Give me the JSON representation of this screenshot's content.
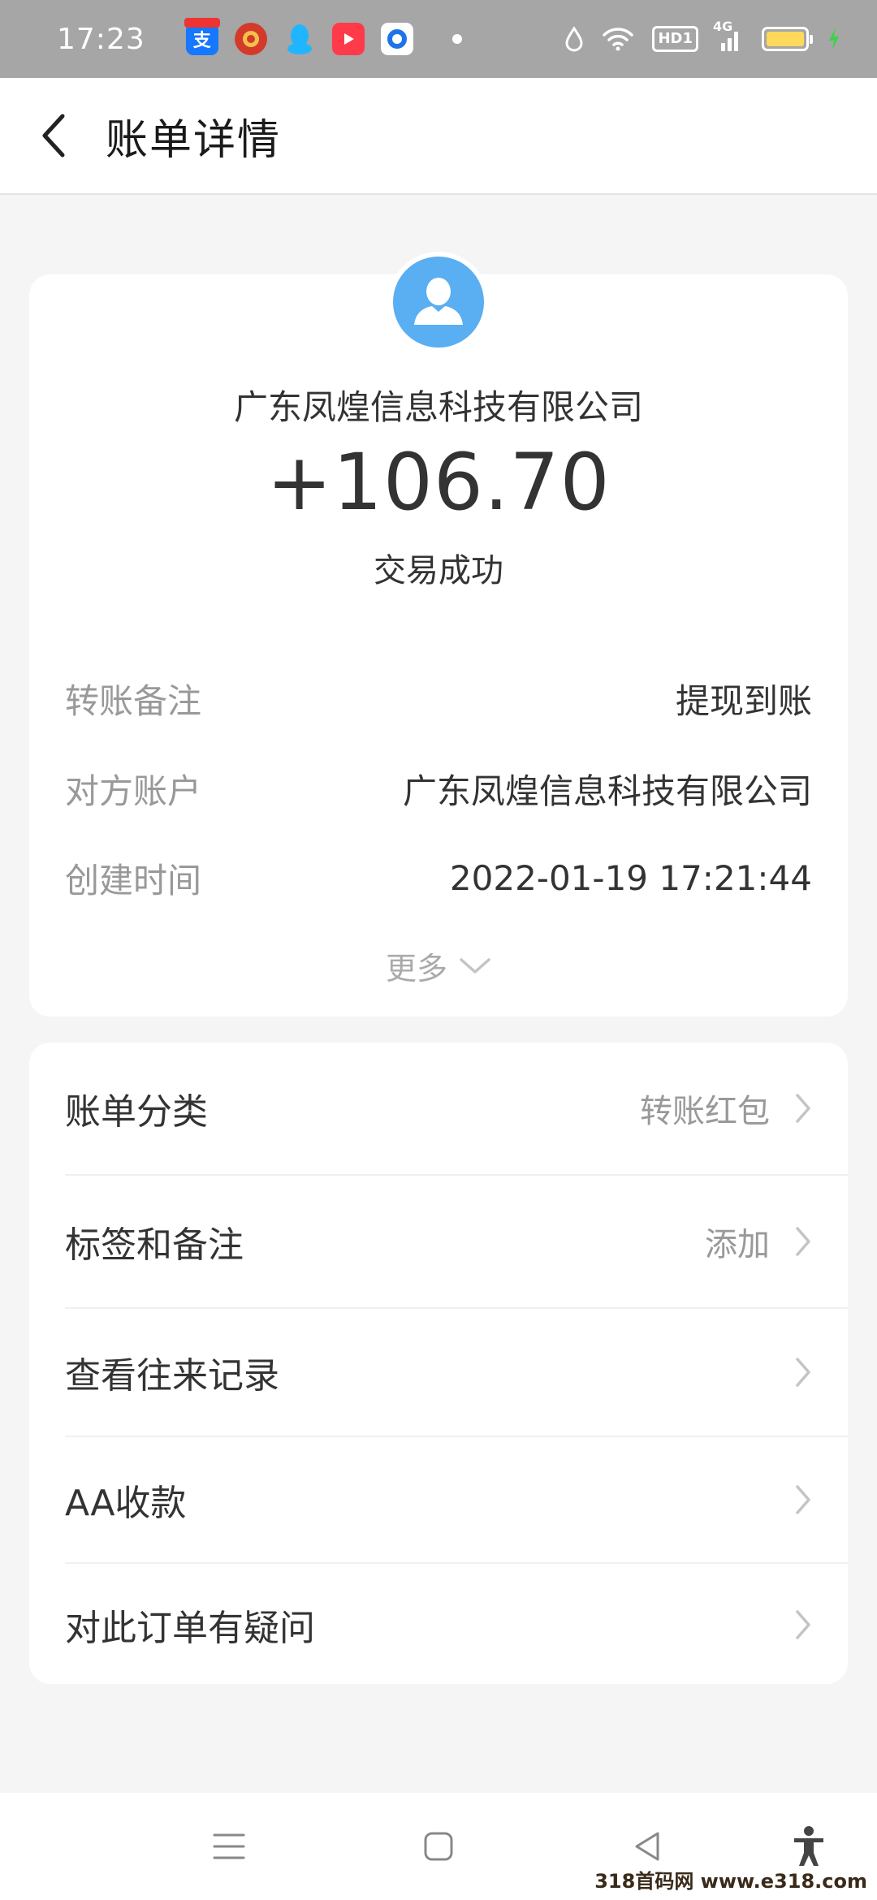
{
  "status_bar": {
    "time": "17:23",
    "network": "4G",
    "hd": "HD1",
    "notification_icons": [
      "alipay-icon",
      "emblem-icon",
      "qq-icon",
      "video-icon",
      "browser-icon"
    ]
  },
  "header": {
    "title": "账单详情"
  },
  "summary": {
    "counterparty": "广东凤煌信息科技有限公司",
    "amount": "+106.70",
    "status": "交易成功",
    "details": [
      {
        "label": "转账备注",
        "value": "提现到账"
      },
      {
        "label": "对方账户",
        "value": "广东凤煌信息科技有限公司"
      },
      {
        "label": "创建时间",
        "value": "2022-01-19 17:21:44"
      }
    ],
    "more_label": "更多"
  },
  "actions": [
    {
      "label": "账单分类",
      "value": "转账红包"
    },
    {
      "label": "标签和备注",
      "value": "添加"
    },
    {
      "label": "查看往来记录",
      "value": ""
    },
    {
      "label": "AA收款",
      "value": ""
    },
    {
      "label": "对此订单有疑问",
      "value": ""
    }
  ],
  "watermark": "318首码网 www.e318.com",
  "colors": {
    "status_bar_bg": "#a6a6a6",
    "avatar_bg": "#5aaef2",
    "page_bg": "#f5f5f5",
    "secondary_text": "#999999",
    "battery_fill": "#ffd85c"
  }
}
